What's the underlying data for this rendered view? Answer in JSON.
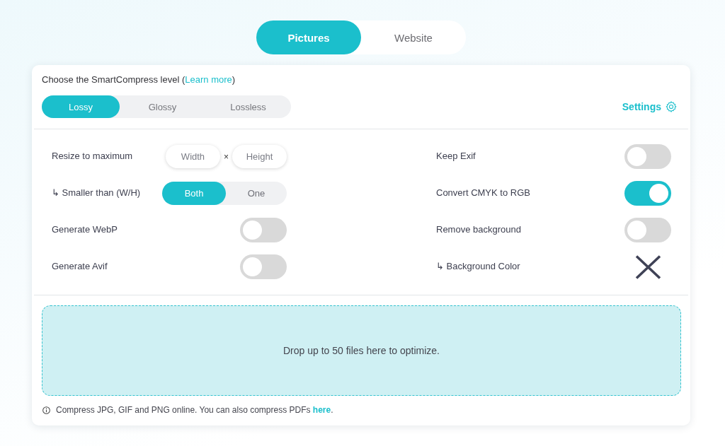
{
  "mode_tabs": [
    {
      "label": "Pictures",
      "selected": true
    },
    {
      "label": "Website",
      "selected": false
    }
  ],
  "level_panel": {
    "prompt": "Choose the SmartCompress level (",
    "prompt_link": "Learn more",
    "prompt_end": ")",
    "options": [
      {
        "label": "Lossy",
        "selected": true
      },
      {
        "label": "Glossy",
        "selected": false
      },
      {
        "label": "Lossless",
        "selected": false
      }
    ],
    "settings_link": "Settings"
  },
  "settings": {
    "columns": [
      {
        "rows": [
          {
            "kind": "size",
            "label": "Resize to maximum",
            "fields": [
              {
                "placeholder": "Width"
              },
              {
                "placeholder": "Height"
              }
            ],
            "separator": "×"
          },
          {
            "kind": "choice",
            "label": "↳ Smaller than (W/H)",
            "options": [
              {
                "label": "Both",
                "selected": true
              },
              {
                "label": "One",
                "selected": false
              }
            ]
          },
          {
            "kind": "toggle",
            "label": "Generate WebP",
            "on": false
          },
          {
            "kind": "toggle",
            "label": "Generate Avif",
            "on": false
          }
        ]
      },
      {
        "rows": [
          {
            "kind": "toggle",
            "label": "Keep Exif",
            "on": false
          },
          {
            "kind": "toggle",
            "label": "Convert CMYK to RGB",
            "on": true
          },
          {
            "kind": "toggle",
            "label": "Remove background",
            "on": false
          },
          {
            "kind": "color",
            "label": "↳ Background Color"
          }
        ]
      }
    ]
  },
  "drop_zone": {
    "text": "Drop up to 50 files here to optimize."
  },
  "footer_note": {
    "text": "Compress JPG, GIF and PNG online. You can also compress PDFs",
    "link": "here",
    "end": "."
  }
}
